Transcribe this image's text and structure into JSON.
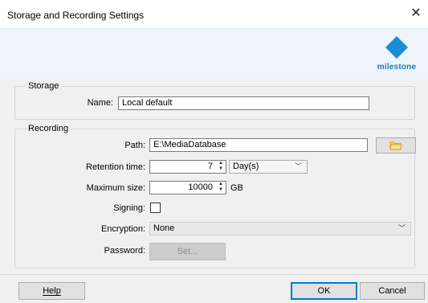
{
  "window": {
    "title": "Storage and Recording Settings",
    "close_glyph": "✕"
  },
  "brand": {
    "logo_text": "milestone",
    "accent": "#1a8fd6"
  },
  "storage": {
    "group_label": "Storage",
    "name_label": "Name:",
    "name_value": "Local default"
  },
  "recording": {
    "group_label": "Recording",
    "path_label": "Path:",
    "path_value": "E:\\MediaDatabase",
    "browse_icon": "folder-icon",
    "retention_label": "Retention time:",
    "retention_value": "7",
    "retention_unit": "Day(s)",
    "max_size_label": "Maximum size:",
    "max_size_value": "10000",
    "max_size_unit": "GB",
    "signing_label": "Signing:",
    "encryption_label": "Encryption:",
    "encryption_value": "None",
    "password_label": "Password:",
    "password_button": "Set..."
  },
  "footer": {
    "help": "Help",
    "ok": "OK",
    "cancel": "Cancel"
  }
}
